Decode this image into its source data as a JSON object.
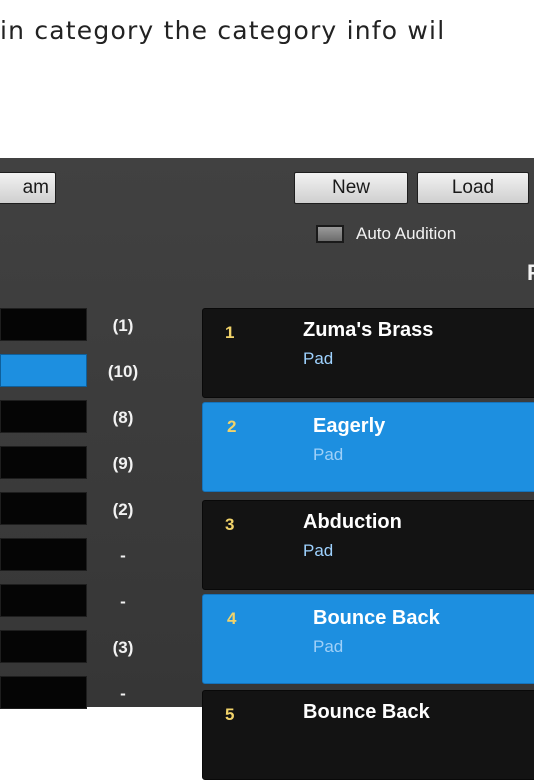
{
  "doc_text": "in category the category info wil",
  "toolbar": {
    "param_label": "am",
    "new_label": "New",
    "load_label": "Load",
    "auto_audition_label": "Auto Audition",
    "edge_letter": "P"
  },
  "category_counts": [
    "(1)",
    "(10)",
    "(8)",
    "(9)",
    "(2)",
    "-",
    "-",
    "(3)",
    "-"
  ],
  "presets": [
    {
      "num": "1",
      "name": "Zuma's Brass",
      "category": "Pad"
    },
    {
      "num": "2",
      "name": "Eagerly",
      "category": "Pad"
    },
    {
      "num": "3",
      "name": "Abduction",
      "category": "Pad"
    },
    {
      "num": "4",
      "name": "Bounce Back",
      "category": "Pad"
    },
    {
      "num": "5",
      "name": "Bounce Back",
      "category": ""
    }
  ],
  "colors": {
    "selected": "#1d8fe0",
    "panel_bg": "#3a3a3a",
    "row_bg": "#131313",
    "number": "#f1d36a"
  }
}
